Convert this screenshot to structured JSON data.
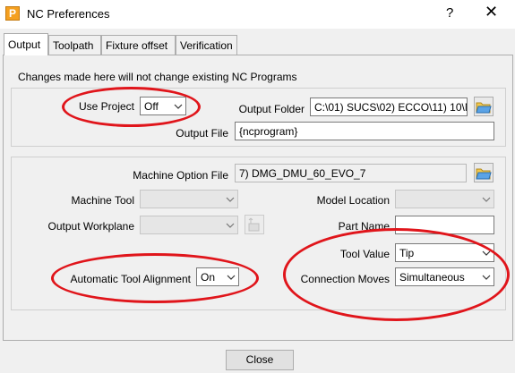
{
  "window": {
    "title": "NC Preferences",
    "help": "?",
    "close": "✕",
    "app_letter": "P"
  },
  "tabs": [
    {
      "label": "Output",
      "active": true
    },
    {
      "label": "Toolpath",
      "active": false
    },
    {
      "label": "Fixture offset",
      "active": false
    },
    {
      "label": "Verification",
      "active": false
    }
  ],
  "output": {
    "notice": "Changes made here will not change existing NC Programs",
    "use_project_label": "Use Project",
    "use_project_value": "Off",
    "output_folder_label": "Output Folder",
    "output_folder_value": "C:\\01) SUCS\\02) ECCO\\11) 10\\N",
    "output_file_label": "Output File",
    "output_file_value": "{ncprogram}"
  },
  "machine": {
    "option_file_label": "Machine Option File",
    "option_file_value": "7) DMG_DMU_60_EVO_7",
    "machine_tool_label": "Machine Tool",
    "machine_tool_value": "",
    "model_location_label": "Model Location",
    "model_location_value": "",
    "output_workplane_label": "Output Workplane",
    "output_workplane_value": "",
    "part_name_label": "Part Name",
    "part_name_value": "",
    "tool_value_label": "Tool Value",
    "tool_value_value": "Tip",
    "auto_align_label": "Automatic Tool Alignment",
    "auto_align_value": "On",
    "connection_moves_label": "Connection Moves",
    "connection_moves_value": "Simultaneous"
  },
  "footer": {
    "close_label": "Close"
  },
  "colors": {
    "highlight_ring": "#e0151b",
    "folder_icon": "#3b8fd8"
  }
}
